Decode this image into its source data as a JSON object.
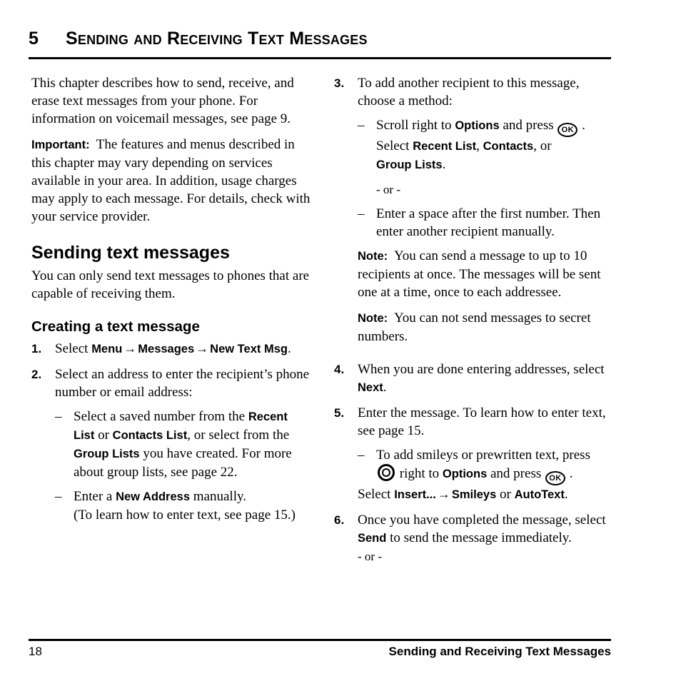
{
  "header": {
    "chapter_number": "5",
    "chapter_title": "Sending and Receiving Text Messages"
  },
  "left_column": {
    "intro_paragraph": "This chapter describes how to send, receive, and erase text messages from your phone. For information on voicemail messages, see page 9.",
    "important_label": "Important:",
    "important_text": "The features and menus described in this chapter may vary depending on services available in your area. In addition, usage charges may apply to each message. For details, check with your service provider.",
    "section_heading": "Sending text messages",
    "section_paragraph": "You can only send text messages to phones that are capable of receiving them.",
    "subsection_heading": "Creating a text message",
    "step1": {
      "number": "1.",
      "text_select": "Select ",
      "menu": "Menu",
      "arrow1": "→",
      "messages": "Messages",
      "arrow2": "→",
      "new_text_msg": "New Text Msg",
      "period": "."
    },
    "step2": {
      "number": "2.",
      "text": "Select an address to enter the recipient’s phone number or email address:",
      "bullet1": {
        "dash": "–",
        "part1": "Select a saved number from the ",
        "recent_list": "Recent List",
        "part2": " or ",
        "contacts_list": "Contacts List",
        "part3": ", or select from the ",
        "group_lists": "Group Lists",
        "part4": " you have created. For more about group lists, see page 22."
      },
      "bullet2": {
        "dash": "–",
        "part1": "Enter a ",
        "new_address": "New Address",
        "part2": " manually.",
        "line2": "(To learn how to enter text, see page 15.)"
      }
    }
  },
  "right_column": {
    "step3": {
      "number": "3.",
      "text": "To add another recipient to this message, choose a method:",
      "bullet1": {
        "dash": "–",
        "part1": "Scroll right to ",
        "options": "Options",
        "part2": " and press ",
        "ok_icon_label": "OK",
        "part3": " .",
        "part4": "Select ",
        "recent_list": "Recent List",
        "part5": ", ",
        "contacts": "Contacts",
        "part6": ", or ",
        "group_lists": "Group Lists",
        "part7": "."
      },
      "or_separator": "- or -",
      "bullet2": {
        "dash": "–",
        "text": "Enter a space after the first number. Then enter another recipient manually."
      },
      "note1_label": "Note:",
      "note1_text": "You can send a message to up to 10 recipients at once. The messages will be sent one at a time, once to each addressee.",
      "note2_label": "Note:",
      "note2_text": "You can not send messages to secret numbers."
    },
    "step4": {
      "number": "4.",
      "part1": "When you are done entering addresses, select ",
      "next": "Next",
      "part2": "."
    },
    "step5": {
      "number": "5.",
      "text": "Enter the message. To learn how to enter text, see page 15.",
      "bullet1": {
        "dash": "–",
        "part1": "To add smileys or prewritten text, press ",
        "nav_icon_label": "navigation-key",
        "part2": " right to ",
        "options": "Options",
        "part3": " and press ",
        "ok_icon_label": "OK",
        "part4": " .",
        "part5": "Select ",
        "insert": "Insert...",
        "arrow": "→",
        "smileys": "Smileys",
        "part6": " or ",
        "autotext": "AutoText",
        "part7": "."
      }
    },
    "step6": {
      "number": "6.",
      "part1": "Once you have completed the message, select ",
      "send": "Send",
      "part2": " to send the message immediately.",
      "or_separator": "- or -"
    }
  },
  "footer": {
    "page_number": "18",
    "running_title": "Sending and Receiving Text Messages"
  }
}
